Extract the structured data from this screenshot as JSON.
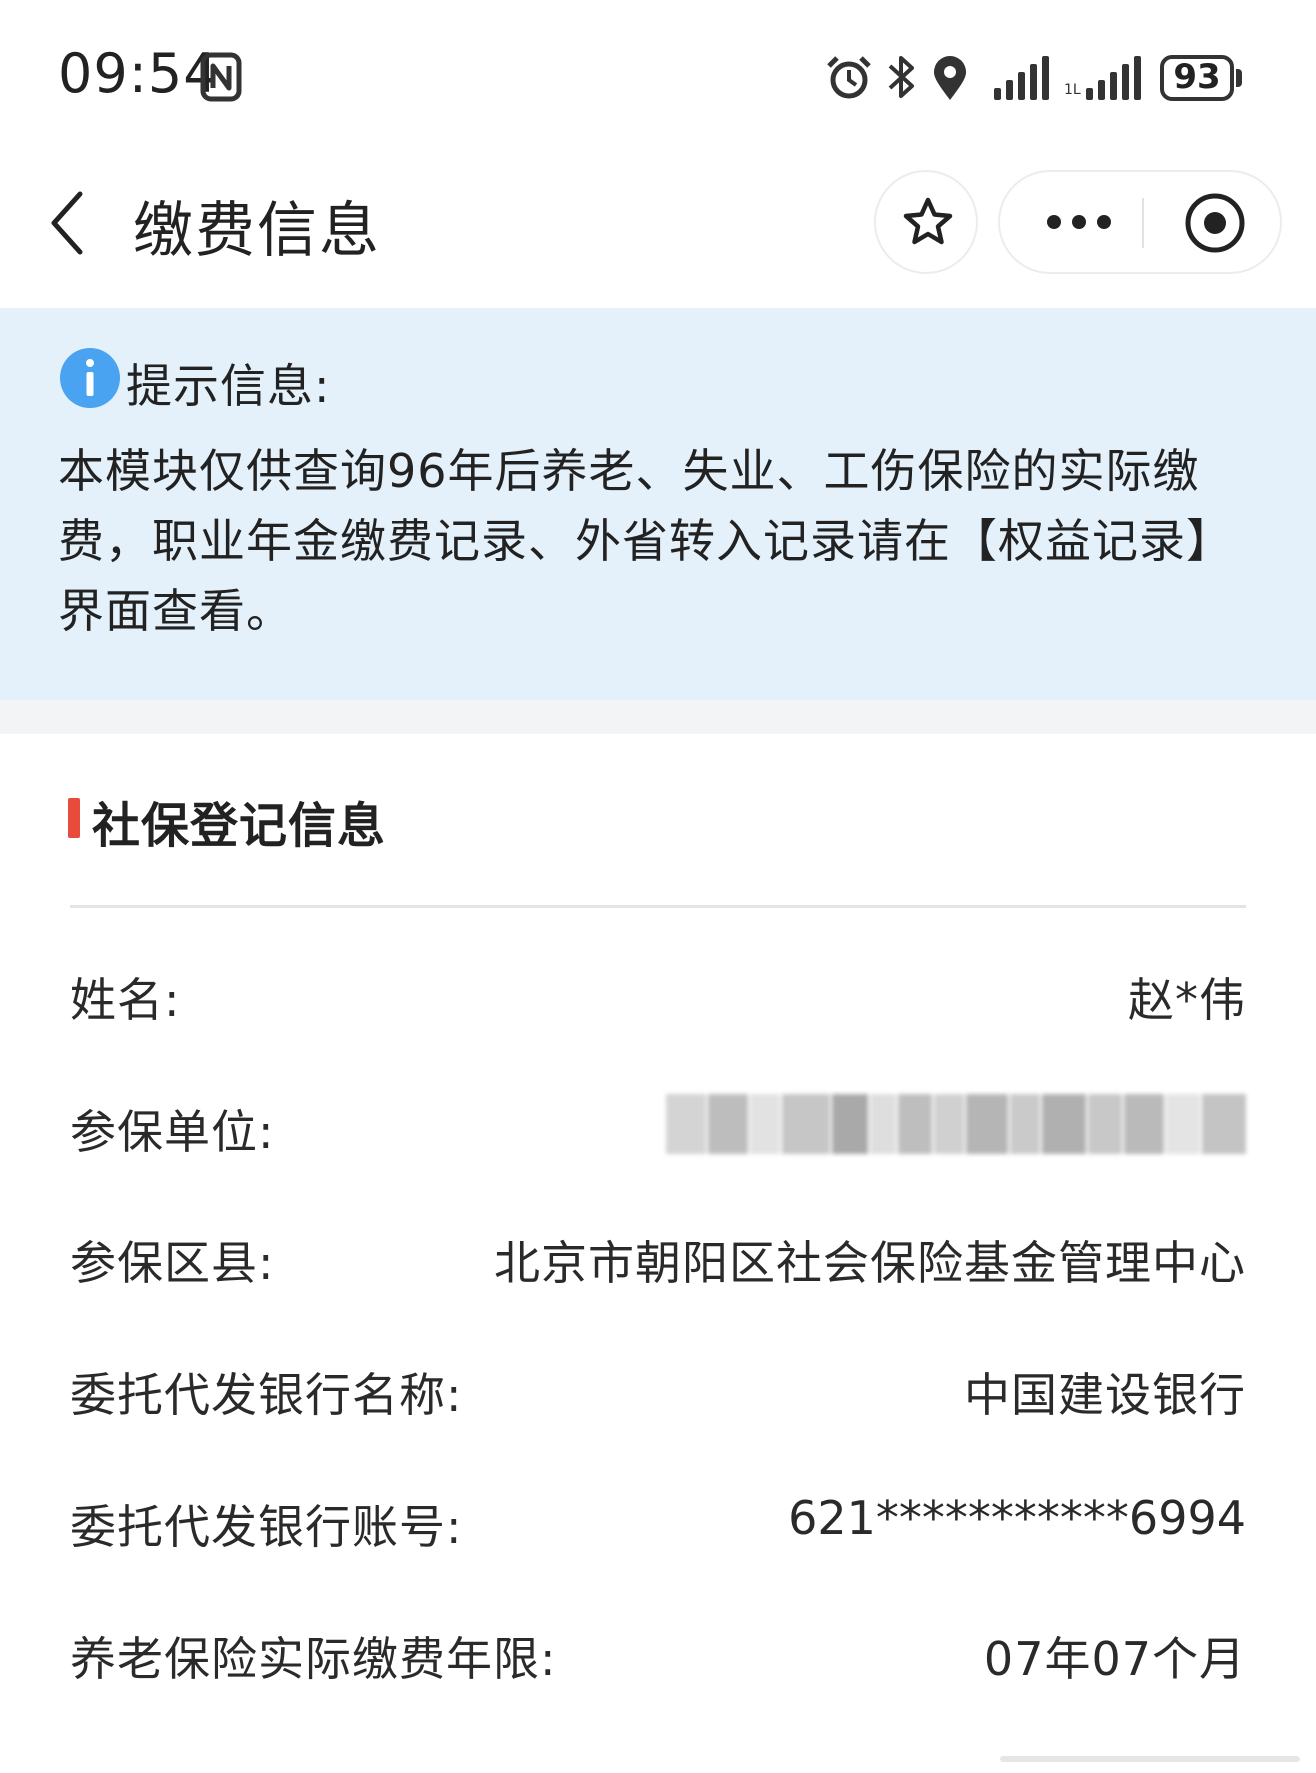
{
  "status_bar": {
    "time": "09:54",
    "battery": "93",
    "icons": [
      "nfc-icon",
      "alarm-icon",
      "bluetooth-icon",
      "location-icon",
      "signal-icon",
      "signal-icon"
    ]
  },
  "nav": {
    "title": "缴费信息",
    "icons": [
      "back-icon",
      "star-icon",
      "more-icon",
      "target-icon"
    ]
  },
  "notice": {
    "title": "提示信息:",
    "body": "本模块仅供查询96年后养老、失业、工伤保险的实际缴费，职业年金缴费记录、外省转入记录请在【权益记录】界面查看。",
    "icon": "info-icon"
  },
  "section": {
    "title": "社保登记信息",
    "rows": [
      {
        "label": "姓名:",
        "value": "赵*伟"
      },
      {
        "label": "参保单位:",
        "value": ""
      },
      {
        "label": "参保区县:",
        "value": "北京市朝阳区社会保险基金管理中心"
      },
      {
        "label": "委托代发银行名称:",
        "value": "中国建设银行"
      },
      {
        "label": "委托代发银行账号:",
        "value": "621***********6994"
      },
      {
        "label": "养老保险实际缴费年限:",
        "value": "07年07个月"
      }
    ]
  },
  "colors": {
    "notice_bg": "#e4f1fb",
    "info_icon": "#4aa3f0",
    "section_marker": "#e84a3c"
  }
}
